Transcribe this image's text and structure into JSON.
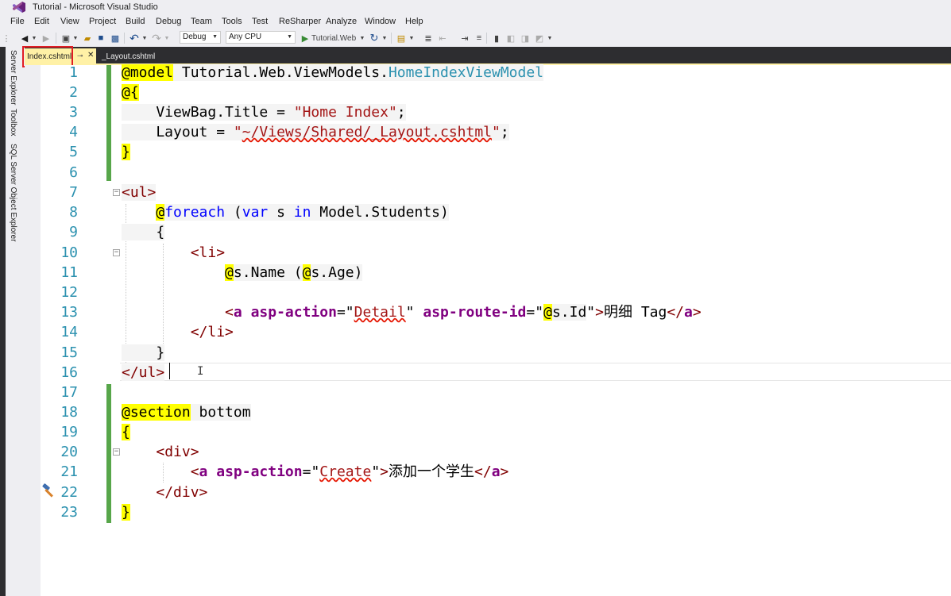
{
  "window": {
    "title": "Tutorial - Microsoft Visual Studio"
  },
  "menu": [
    "File",
    "Edit",
    "View",
    "Project",
    "Build",
    "Debug",
    "Team",
    "Tools",
    "Test",
    "ReSharper",
    "Analyze",
    "Window",
    "Help"
  ],
  "toolbar": {
    "config": "Debug",
    "platform": "Any CPU",
    "run_label": "Tutorial.Web"
  },
  "sidebar": {
    "items": [
      "Server Explorer",
      "Toolbox",
      "SQL Server Object Explorer"
    ]
  },
  "tabs": {
    "active": "Index.cshtml",
    "other": "_Layout.cshtml"
  },
  "editor": {
    "line_numbers": [
      "1",
      "2",
      "3",
      "4",
      "5",
      "6",
      "7",
      "8",
      "9",
      "10",
      "11",
      "12",
      "13",
      "14",
      "15",
      "16",
      "17",
      "18",
      "19",
      "20",
      "21",
      "22",
      "23"
    ],
    "code": {
      "l1_a": "@model",
      "l1_b": " Tutorial.Web.ViewModels.",
      "l1_c": "HomeIndexViewModel",
      "l2_a": "@{",
      "l3_a": "    ViewBag.Title = ",
      "l3_b": "\"Home Index\"",
      "l3_c": ";",
      "l4_a": "    Layout = ",
      "l4_b": "\"",
      "l4_c": "~/Views/Shared/_Layout.cshtml",
      "l4_d": "\"",
      "l4_e": ";",
      "l5_a": "}",
      "l7_a": "<ul>",
      "l8_a": "    ",
      "l8_b": "@",
      "l8_c": "foreach",
      "l8_d": " (",
      "l8_e": "var",
      "l8_f": " s ",
      "l8_g": "in",
      "l8_h": " Model.Students)",
      "l9_a": "    {",
      "l10_a": "        ",
      "l10_b": "<li>",
      "l11_a": "            ",
      "l11_b": "@",
      "l11_c": "s.Name (",
      "l11_d": "@",
      "l11_e": "s.Age)",
      "l13_a": "            ",
      "l13_b": "<",
      "l13_c": "a",
      "l13_d": " asp-action",
      "l13_e": "=\"",
      "l13_f": "Detail",
      "l13_g": "\"",
      "l13_h": " asp-route-id",
      "l13_i": "=\"",
      "l13_j": "@",
      "l13_k": "s.Id",
      "l13_l": "\"",
      "l13_m": ">",
      "l13_n": "明细 Tag",
      "l13_o": "</",
      "l13_p": "a",
      "l13_q": ">",
      "l14_a": "        ",
      "l14_b": "</li>",
      "l15_a": "    }",
      "l16_a": "</ul>",
      "l18_a": "@section",
      "l18_b": " bottom",
      "l19_a": "{",
      "l20_a": "    ",
      "l20_b": "<div>",
      "l21_a": "        ",
      "l21_b": "<",
      "l21_c": "a",
      "l21_d": " asp-action",
      "l21_e": "=\"",
      "l21_f": "Create",
      "l21_g": "\"",
      "l21_h": ">",
      "l21_i": "添加一个学生",
      "l21_j": "</",
      "l21_k": "a",
      "l21_l": ">",
      "l22_a": "    ",
      "l22_b": "</div>",
      "l23_a": "}"
    }
  },
  "colors": {
    "accent_tab": "#fff1a6",
    "change_bar": "#57a64a",
    "highlight": "#ffff00",
    "red_box": "#e11d24"
  }
}
